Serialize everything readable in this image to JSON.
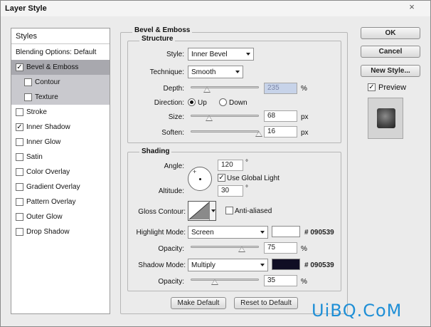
{
  "window": {
    "title": "Layer Style",
    "close_glyph": "×"
  },
  "styles_panel": {
    "header": "Styles",
    "items": [
      {
        "label": "Blending Options: Default",
        "checkbox": false,
        "checked": false,
        "state": "normal"
      },
      {
        "label": "Bevel & Emboss",
        "checkbox": true,
        "checked": true,
        "state": "selected"
      },
      {
        "label": "Contour",
        "checkbox": true,
        "checked": false,
        "state": "sub"
      },
      {
        "label": "Texture",
        "checkbox": true,
        "checked": false,
        "state": "sub"
      },
      {
        "label": "Stroke",
        "checkbox": true,
        "checked": false,
        "state": "normal"
      },
      {
        "label": "Inner Shadow",
        "checkbox": true,
        "checked": true,
        "state": "normal"
      },
      {
        "label": "Inner Glow",
        "checkbox": true,
        "checked": false,
        "state": "normal"
      },
      {
        "label": "Satin",
        "checkbox": true,
        "checked": false,
        "state": "normal"
      },
      {
        "label": "Color Overlay",
        "checkbox": true,
        "checked": false,
        "state": "normal"
      },
      {
        "label": "Gradient Overlay",
        "checkbox": true,
        "checked": false,
        "state": "normal"
      },
      {
        "label": "Pattern Overlay",
        "checkbox": true,
        "checked": false,
        "state": "normal"
      },
      {
        "label": "Outer Glow",
        "checkbox": true,
        "checked": false,
        "state": "normal"
      },
      {
        "label": "Drop Shadow",
        "checkbox": true,
        "checked": false,
        "state": "normal"
      }
    ]
  },
  "buttons": {
    "ok": "OK",
    "cancel": "Cancel",
    "new_style": "New Style...",
    "preview_label": "Preview",
    "preview_checked": true,
    "make_default": "Make Default",
    "reset_default": "Reset to Default"
  },
  "bevel": {
    "title": "Bevel & Emboss",
    "structure_title": "Structure",
    "style_label": "Style:",
    "style_value": "Inner Bevel",
    "technique_label": "Technique:",
    "technique_value": "Smooth",
    "depth_label": "Depth:",
    "depth_value": "235",
    "depth_unit": "%",
    "depth_level": 0.235,
    "direction_label": "Direction:",
    "direction_up": "Up",
    "direction_down": "Down",
    "direction_selected": "Up",
    "size_label": "Size:",
    "size_value": "68",
    "size_unit": "px",
    "size_level": 0.27,
    "soften_label": "Soften:",
    "soften_value": "16",
    "soften_unit": "px",
    "soften_level": 1.0
  },
  "shading": {
    "title": "Shading",
    "angle_label": "Angle:",
    "angle_value": "120",
    "degree": "°",
    "use_global_light": "Use Global Light",
    "use_global_light_checked": true,
    "altitude_label": "Altitude:",
    "altitude_value": "30",
    "gloss_contour_label": "Gloss Contour:",
    "anti_aliased": "Anti-aliased",
    "anti_aliased_checked": false,
    "highlight_mode_label": "Highlight Mode:",
    "highlight_mode_value": "Screen",
    "highlight_color": "#ffffff",
    "highlight_hex": "# 090539",
    "highlight_opacity_label": "Opacity:",
    "highlight_opacity_value": "75",
    "highlight_opacity_level": 0.75,
    "shadow_mode_label": "Shadow Mode:",
    "shadow_mode_value": "Multiply",
    "shadow_color": "#100e24",
    "shadow_hex": "# 090539",
    "shadow_opacity_label": "Opacity:",
    "shadow_opacity_value": "35",
    "shadow_opacity_level": 0.35,
    "percent": "%"
  },
  "watermark": "UiBQ.CoM"
}
